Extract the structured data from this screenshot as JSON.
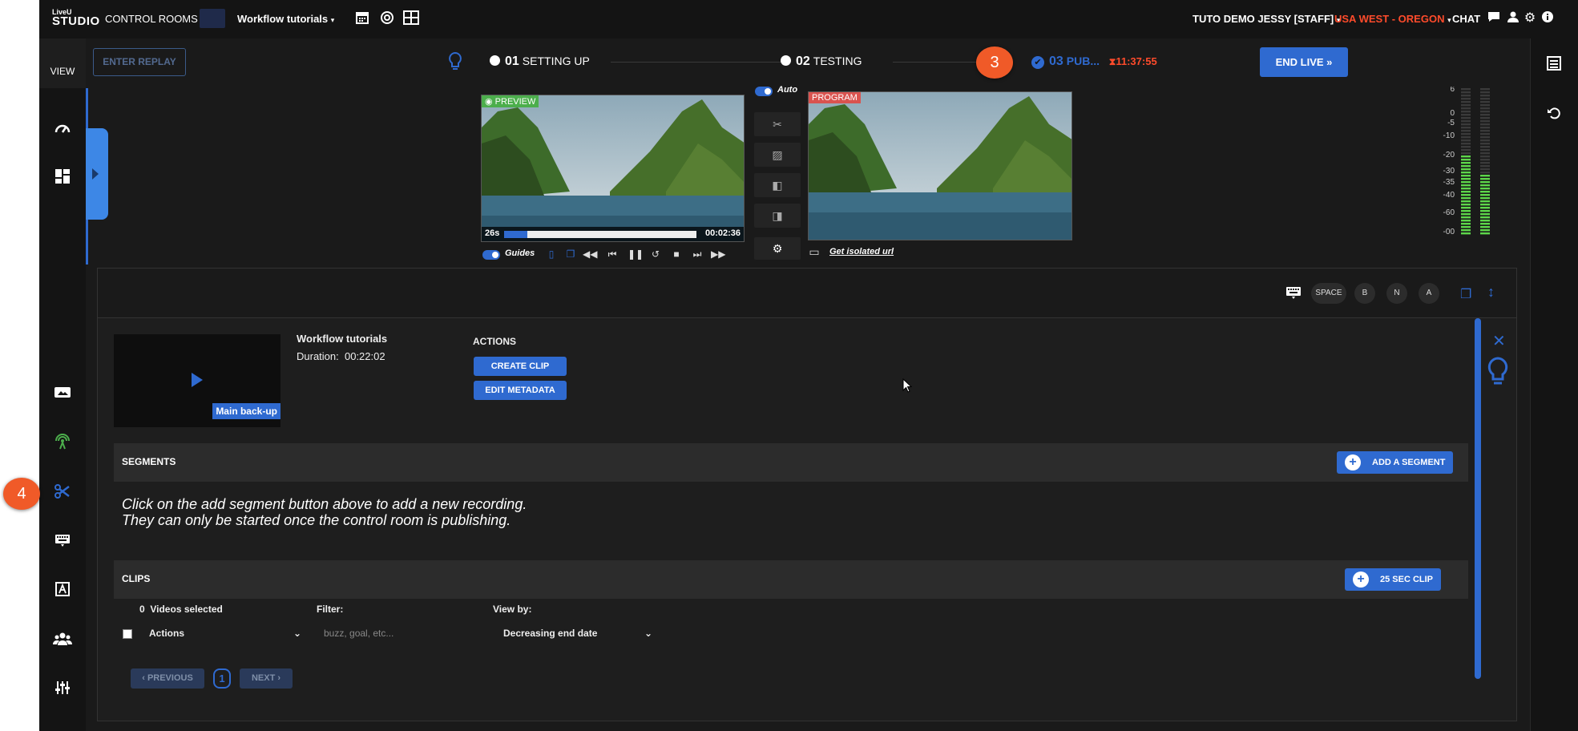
{
  "topbar": {
    "logo_small": "LiveU",
    "logo_big": "STUDIO",
    "control_rooms": "CONTROL ROOMS",
    "workflow": "Workflow tutorials",
    "user": "TUTO DEMO JESSY [STAFF]",
    "region": "USA WEST - OREGON",
    "chat": "CHAT"
  },
  "leftbar": {
    "view": "VIEW",
    "callout": "4"
  },
  "replay": {
    "label": "ENTER REPLAY"
  },
  "steps": {
    "s1_num": "01",
    "s1_label": "SETTING UP",
    "s2_num": "02",
    "s2_label": "TESTING",
    "s3_num": "03",
    "s3_label": "PUB...",
    "s3_timer": "11:37:55",
    "callout": "3"
  },
  "end_live": {
    "label": "END LIVE"
  },
  "preview": {
    "label": "PREVIEW",
    "elapsed": "26s",
    "remaining": "00:02:36",
    "progress": 0.12
  },
  "program": {
    "label": "PROGRAM"
  },
  "controls": {
    "auto": "Auto",
    "guides": "Guides",
    "isolated_url": "Get isolated url"
  },
  "meters": {
    "labels": [
      "6",
      "0",
      "-5",
      "-10",
      "-20",
      "-30",
      "-35",
      "-40",
      "-60",
      "-00"
    ],
    "level_left": 0.55,
    "level_right": 0.42
  },
  "shortcuts": {
    "space": "SPACE",
    "b": "B",
    "n": "N",
    "a": "A"
  },
  "recording": {
    "tag": "Main back-up",
    "title": "Workflow tutorials",
    "duration_label": "Duration:",
    "duration": "00:22:02",
    "actions_title": "ACTIONS",
    "create_clip": "CREATE CLIP",
    "edit_metadata": "EDIT METADATA"
  },
  "segments": {
    "title": "SEGMENTS",
    "add_button": "ADD A SEGMENT",
    "message_line1": "Click on the add segment button above to add a new recording.",
    "message_line2": "They can only be started once the control room is publishing."
  },
  "clips": {
    "title": "CLIPS",
    "clip_button": "25 SEC CLIP",
    "selected_count": "0",
    "selected_label": "Videos selected",
    "filter_label": "Filter:",
    "view_by_label": "View by:",
    "actions_select": "Actions",
    "filter_placeholder": "buzz, goal, etc...",
    "view_by_value": "Decreasing end date",
    "prev": "PREVIOUS",
    "page": "1",
    "next": "NEXT"
  },
  "colors": {
    "accent": "#2f6ad0",
    "danger": "#ff4b2b",
    "callout": "#f05a28",
    "preview": "#4cae4c",
    "program": "#d9534f"
  }
}
